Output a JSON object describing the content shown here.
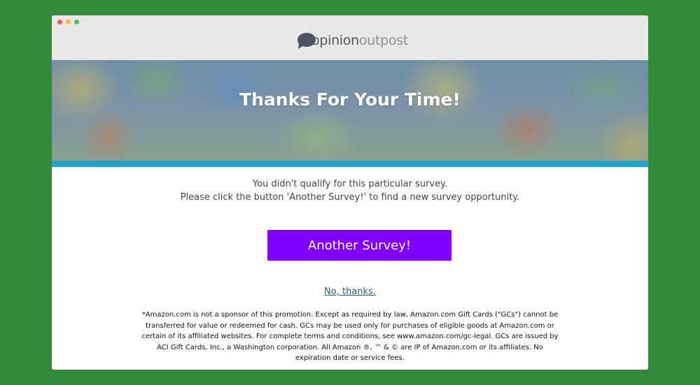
{
  "app": {
    "brand_part1": "opinion",
    "brand_part2": "outpost"
  },
  "hero": {
    "title": "Thanks For Your Time!"
  },
  "message": {
    "line1": "You didn't qualify for this particular survey.",
    "line2": "Please click the button 'Another Survey!' to find a new survey opportunity."
  },
  "actions": {
    "another_survey_label": "Another Survey!",
    "decline_label": "No, thanks."
  },
  "disclaimer": {
    "text": "*Amazon.com is not a sponsor of this promotion. Except as required by law, Amazon.com Gift Cards (\"GCs\") cannot be transferred for value or redeemed for cash. GCs may be used only for purchases of eligible goods at Amazon.com or certain of its affiliated websites. For complete terms and conditions, see www.amazon.com/gc-legal. GCs are issued by ACI Gift Cards, Inc., a Washington corporation. All Amazon ®, ™ & © are IP of Amazon.com or its affiliates. No expiration date or service fees."
  },
  "colors": {
    "page_background": "#338a3b",
    "accent_bar": "#2aa0c4",
    "button": "#7f00ff",
    "logo_dark": "#4c5560",
    "logo_light": "#8a9097"
  },
  "icons": {
    "window_controls": [
      "close-dot",
      "minimize-dot",
      "maximize-dot"
    ],
    "logo": "speech-bubble-icon"
  }
}
